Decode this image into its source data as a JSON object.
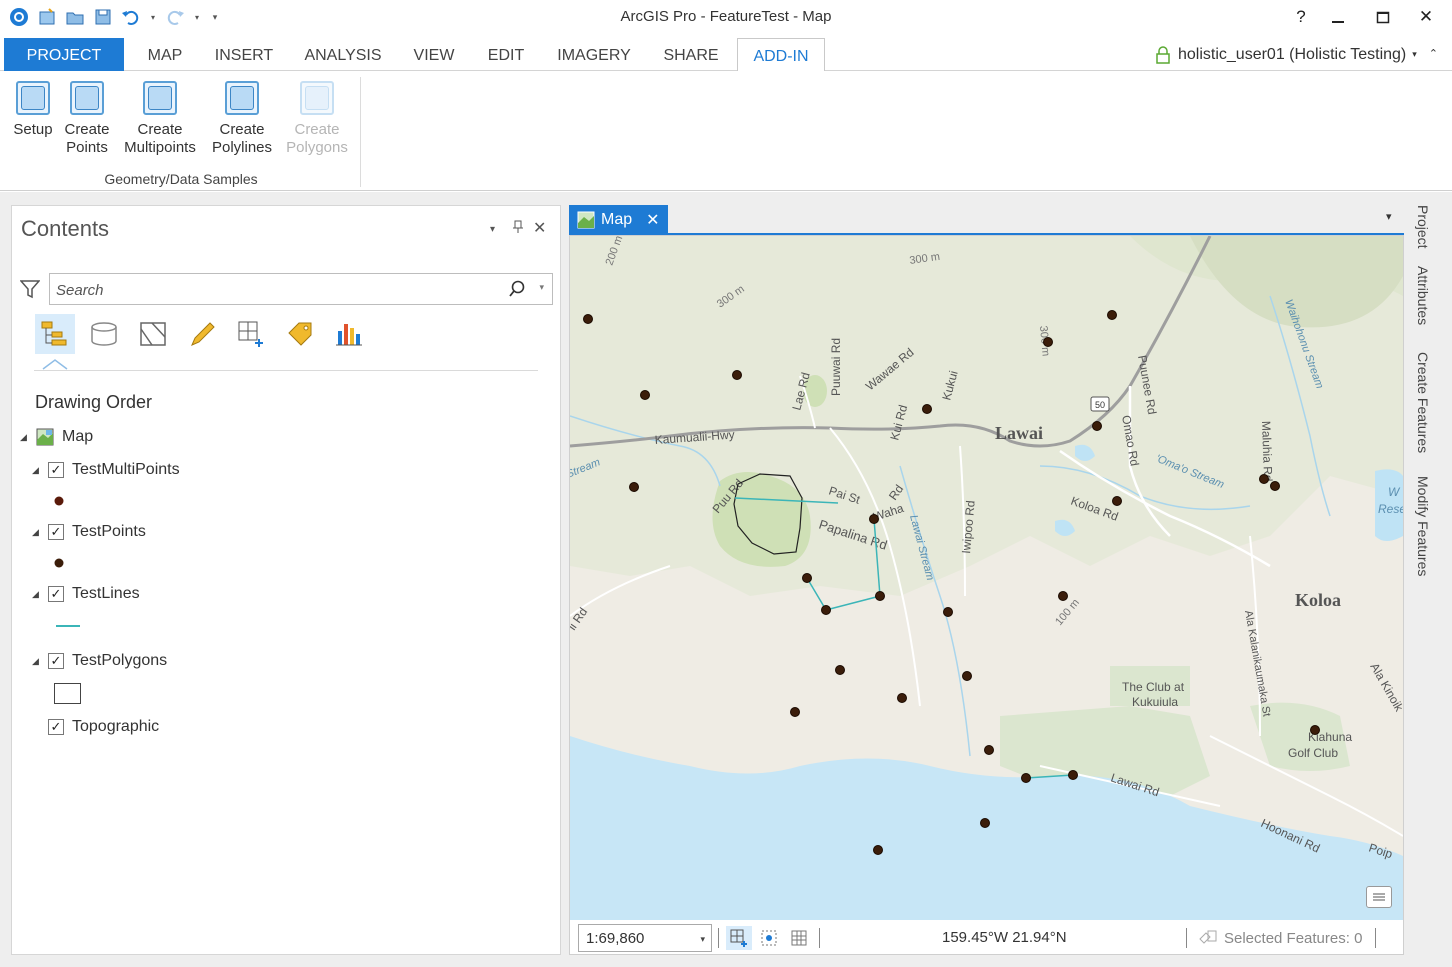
{
  "window": {
    "title": "ArcGIS Pro - FeatureTest - Map",
    "help": "?",
    "minimize": "_",
    "maximize": "□",
    "close": "✕"
  },
  "ribbon": {
    "tabs": [
      "PROJECT",
      "MAP",
      "INSERT",
      "ANALYSIS",
      "VIEW",
      "EDIT",
      "IMAGERY",
      "SHARE",
      "ADD-IN"
    ],
    "active_tab": "ADD-IN",
    "user": "holistic_user01 (Holistic Testing)",
    "group_label": "Geometry/Data Samples",
    "buttons": [
      {
        "line1": "Setup",
        "line2": "",
        "enabled": true
      },
      {
        "line1": "Create",
        "line2": "Points",
        "enabled": true
      },
      {
        "line1": "Create",
        "line2": "Multipoints",
        "enabled": true
      },
      {
        "line1": "Create",
        "line2": "Polylines",
        "enabled": true
      },
      {
        "line1": "Create",
        "line2": "Polygons",
        "enabled": false
      }
    ]
  },
  "contents": {
    "title": "Contents",
    "search_placeholder": "Search",
    "heading": "Drawing Order",
    "map_name": "Map",
    "layers": [
      {
        "name": "TestMultiPoints",
        "checked": true,
        "symbol": "point"
      },
      {
        "name": "TestPoints",
        "checked": true,
        "symbol": "point"
      },
      {
        "name": "TestLines",
        "checked": true,
        "symbol": "line"
      },
      {
        "name": "TestPolygons",
        "checked": true,
        "symbol": "polygon"
      },
      {
        "name": "Topographic",
        "checked": true,
        "symbol": "none"
      }
    ]
  },
  "map_view": {
    "tab_label": "Map",
    "scale": "1:69,860",
    "coordinates": "159.45°W 21.94°N",
    "selected_features": "Selected Features: 0",
    "labels": {
      "lawai": "Lawai",
      "koloa": "Koloa",
      "kaumualii": "Kaumualii-Hwy",
      "koloa_rd": "Koloa Rd",
      "papalina": "Papalina Rd",
      "pai_st": "Pai St",
      "waha": "Waha",
      "rd": "Rd",
      "puu_rd": "Puu Rd",
      "puuwai": "Puuwai Rd",
      "lae_rd": "Lae Rd",
      "wawae": "Wawae Rd",
      "kui_rd": "Kui Rd",
      "kukui": "Kukui",
      "iwipoo": "Iwipoo Rd",
      "lawai_stream": "Lawai Stream",
      "omaa_stream": "'Oma'o Stream",
      "puunee": "Puunee Rd",
      "omao_rd": "Omao Rd",
      "maluhia": "Maluhia Rd",
      "waihohonu": "Waihohonu Stream",
      "club": "The Club at",
      "kukuiula": "Kukuiula",
      "kiahuna": "Kiahuna",
      "golf": "Golf Club",
      "lawai_rd": "Lawai Rd",
      "hoonani": "Hoonani Rd",
      "poip": "Poip",
      "ala_kinoik": "Ala Kinoik",
      "ala_kalani": "Ala Kalanikaumaka St",
      "m100": "100 m",
      "m200": "200 m",
      "m300": "300 m",
      "m300b": "300 m",
      "m300c": "300 m",
      "hwy50": "50",
      "stream_left": "Stream",
      "rd_left": "li Rd",
      "wres": "W",
      "res": "Rese"
    }
  },
  "side_tabs": [
    "Project",
    "Attributes",
    "Create Features",
    "Modify Features"
  ],
  "colors": {
    "accent": "#1e7bd4",
    "point": "#3b1d0a",
    "line": "#3bb5b8"
  }
}
